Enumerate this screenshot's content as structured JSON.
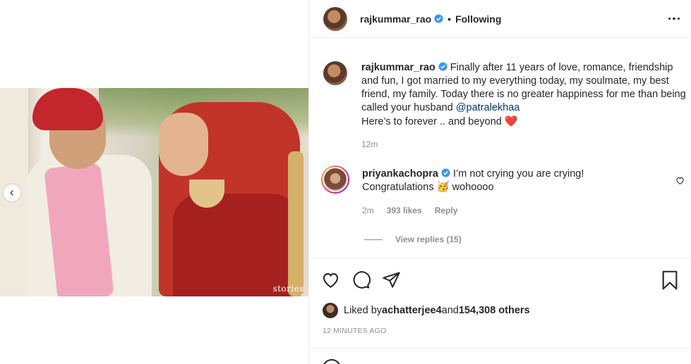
{
  "post": {
    "photo_watermark": "stories"
  },
  "header": {
    "username": "rajkummar_rao",
    "separator": "•",
    "follow_status": "Following"
  },
  "caption": {
    "username": "rajkummar_rao",
    "text_1": " Finally after 11 years of love, romance, friendship and fun, I got married to my everything today, my soulmate, my best friend, my family. Today there is no greater happiness for me than being called your husband ",
    "mention": "@patralekhaa",
    "text_2": "Here’s to forever .. and beyond ",
    "emoji": "❤️",
    "time": "12m"
  },
  "comment": {
    "username": "priyankachopra",
    "text_1": " I’m not crying you are crying!",
    "text_2": "Congratulations ",
    "emoji": "🥳",
    "text_3": " wohoooo",
    "time": "2m",
    "likes": "393 likes",
    "reply_label": "Reply"
  },
  "replies": {
    "label": "View replies (15)"
  },
  "likes": {
    "prefix": "Liked by ",
    "user": "achatterjee4",
    "middle": " and ",
    "count": "154,308 others"
  },
  "timestamp": "12 MINUTES AGO",
  "colors": {
    "verified": "#3897f0",
    "mention": "#00376b",
    "muted": "#8e8e8e",
    "text": "#262626"
  }
}
